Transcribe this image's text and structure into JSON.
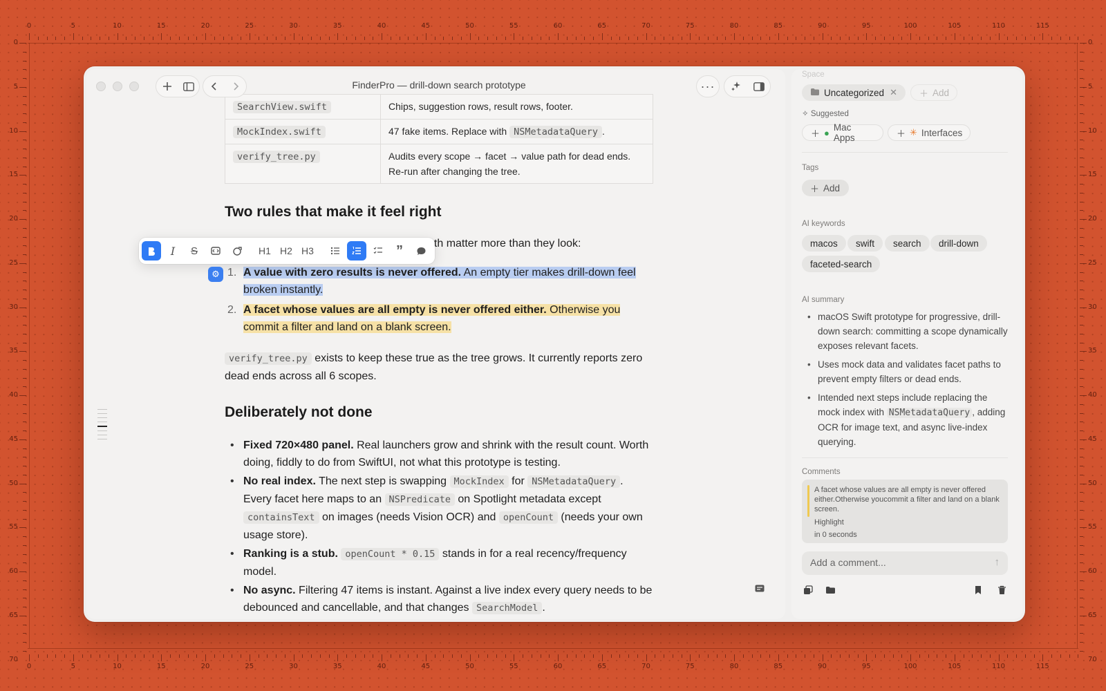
{
  "ruler": {
    "top_labels": [
      "0",
      "5",
      "10",
      "15",
      "20",
      "25",
      "30",
      "35",
      "40",
      "45",
      "50",
      "55",
      "60",
      "65",
      "70",
      "75",
      "80",
      "85",
      "90",
      "95",
      "100",
      "105",
      "110",
      "115"
    ],
    "side_labels": [
      "0",
      "5",
      "10",
      "15",
      "20",
      "25",
      "30",
      "35",
      "40",
      "45",
      "50",
      "55",
      "60",
      "65",
      "70"
    ]
  },
  "window": {
    "title": "FinderPro — drill-down search prototype"
  },
  "toolbar": {
    "icons": {
      "new": "plus-icon",
      "sidebar": "sidebar-icon",
      "back": "chevron-left-icon",
      "forward": "chevron-right-icon",
      "more": "ellipsis-icon",
      "ai": "sparkle-icon",
      "panel": "panel-right-icon"
    }
  },
  "doc": {
    "table": [
      {
        "file": "SearchView.swift",
        "desc": "Chips, suggestion rows, result rows, footer."
      },
      {
        "file": "MockIndex.swift",
        "desc_pre": "47 fake items. Replace with ",
        "desc_code": "NSMetadataQuery",
        "desc_post": "."
      },
      {
        "file": "verify_tree.py",
        "desc": "Audits every scope → facet → value path for dead ends. Re-run after changing the tree."
      }
    ],
    "heading_rules": "Two rules that make it feel right",
    "rules_intro": "oth matter more than they look:",
    "rules": [
      {
        "num": "1.",
        "bold": "A value with zero results is never offered.",
        "rest": " An empty tier makes drill-down feel broken instantly."
      },
      {
        "num": "2.",
        "bold": "A facet whose values are all empty is never offered either.",
        "rest": " Otherwise you commit a filter and land on a blank screen."
      }
    ],
    "verify_code": "verify_tree.py",
    "verify_text": " exists to keep these true as the tree grows. It currently reports zero dead ends across all 6 scopes.",
    "heading_not_done": "Deliberately not done",
    "not_done": {
      "item1_bold": "Fixed 720×480 panel.",
      "item1_text": " Real launchers grow and shrink with the result count. Worth doing, fiddly to do from SwiftUI, not what this prototype is testing.",
      "item2_bold": "No real index.",
      "item2_t1": " The next step is swapping ",
      "item2_c1": "MockIndex",
      "item2_t2": " for ",
      "item2_c2": "NSMetadataQuery",
      "item2_t3": ". Every facet here maps to an ",
      "item2_c3": "NSPredicate",
      "item2_t4": " on Spotlight metadata except ",
      "item2_c4": "containsText",
      "item2_t5": " on images (needs Vision OCR) and ",
      "item2_c5": "openCount",
      "item2_t6": " (needs your own usage store).",
      "item3_bold": "Ranking is a stub.",
      "item3_t1": " ",
      "item3_c1": "openCount * 0.15",
      "item3_t2": " stands in for a real recency/frequency model.",
      "item4_bold": "No async.",
      "item4_t1": " Filtering 47 items is instant. Against a live index every query needs to be debounced and cancellable, and that changes ",
      "item4_c1": "SearchModel",
      "item4_t2": "."
    }
  },
  "format_bar": {
    "buttons": [
      "bold-icon",
      "italic-icon",
      "strikethrough-icon",
      "code-icon",
      "link-icon",
      "heading1-icon",
      "heading2-icon",
      "heading3-icon",
      "bullet-list-icon",
      "numbered-list-icon",
      "checklist-icon",
      "quote-icon",
      "comment-icon"
    ],
    "h1": "H1",
    "h2": "H2",
    "h3": "H3",
    "active": "numbered-list-icon"
  },
  "sidebar": {
    "space_label": "Space",
    "space_chip": "Uncategorized",
    "space_add": "Add",
    "suggested_label": "Suggested",
    "suggested": [
      "Mac Apps",
      "Interfaces"
    ],
    "tags_label": "Tags",
    "tags_add": "Add",
    "keywords_label": "AI keywords",
    "keywords": [
      "macos",
      "swift",
      "search",
      "drill-down",
      "faceted-search"
    ],
    "summary_label": "AI summary",
    "summary_1": "macOS Swift prototype for progressive, drill-down search: committing a scope dynamically exposes relevant facets.",
    "summary_2": "Uses mock data and validates facet paths to prevent empty filters or dead ends.",
    "summary_3_pre": "Intended next steps include replacing the mock index with ",
    "summary_3_code": "NSMetadataQuery",
    "summary_3_post": ", adding OCR for image text, and async live-index querying.",
    "comments_label": "Comments",
    "comment_quote": "A facet whose values are all empty is never offered either.Otherwise youcommit a filter and land on a blank screen.",
    "comment_type": "Highlight",
    "comment_time": "in 0 seconds",
    "comment_placeholder": "Add a comment..."
  },
  "colors": {
    "background": "#d2532f",
    "accent": "#2f7bf5",
    "highlight_blue": "#b9cdf1",
    "highlight_yellow": "#f6e1a6"
  }
}
